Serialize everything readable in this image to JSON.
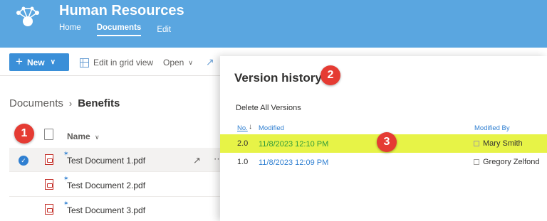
{
  "header": {
    "site_title": "Human Resources",
    "nav": [
      "Home",
      "Documents",
      "Edit"
    ],
    "logo_icon": "network-logo-icon",
    "color": "#5aa6e0"
  },
  "toolbar": {
    "new_label": "New",
    "edit_grid_label": "Edit in grid view",
    "open_label": "Open"
  },
  "breadcrumb": {
    "root": "Documents",
    "current": "Benefits"
  },
  "list": {
    "name_header": "Name",
    "files": [
      {
        "name": "Test Document 1.pdf",
        "selected": true
      },
      {
        "name": "Test Document 2.pdf",
        "selected": false
      },
      {
        "name": "Test Document 3.pdf",
        "selected": false
      }
    ]
  },
  "panel": {
    "title": "Version history",
    "delete_all_label": "Delete All Versions",
    "columns": {
      "no": "No.",
      "modified": "Modified",
      "modified_by": "Modified By"
    },
    "versions": [
      {
        "no": "2.0",
        "modified": "11/8/2023 12:10 PM",
        "modified_by": "Mary Smith",
        "highlighted": true
      },
      {
        "no": "1.0",
        "modified": "11/8/2023 12:09 PM",
        "modified_by": "Gregory Zelfond",
        "highlighted": false
      }
    ]
  },
  "callouts": [
    "1",
    "2",
    "3"
  ],
  "colors": {
    "accent": "#2f7fd1",
    "highlight": "#e7f347",
    "callout": "#e53b33"
  }
}
